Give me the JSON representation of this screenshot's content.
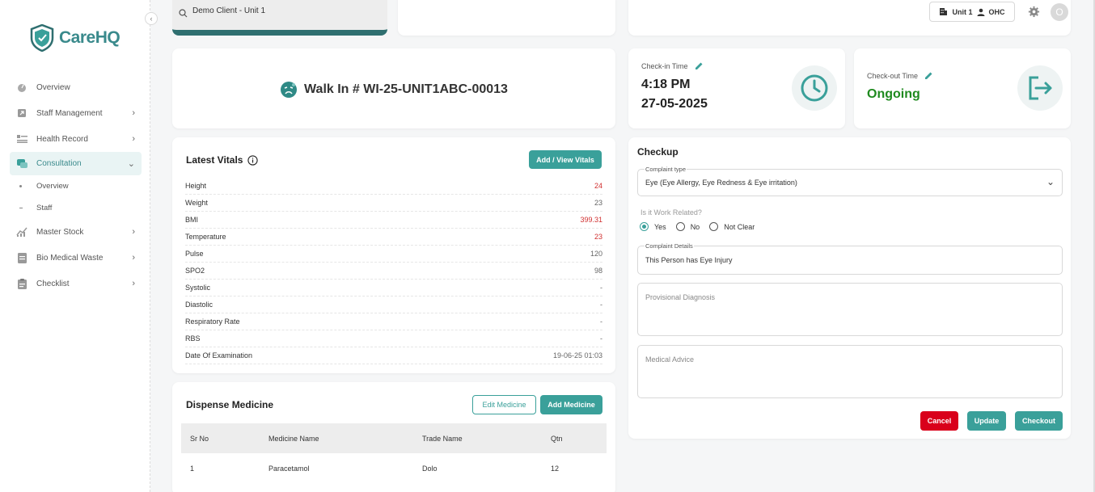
{
  "brand": {
    "name": "CareHQ"
  },
  "sidebar": {
    "items": [
      {
        "label": "Overview",
        "icon": "gauge-icon"
      },
      {
        "label": "Staff Management",
        "icon": "arrow-box-icon"
      },
      {
        "label": "Health Record",
        "icon": "list-icon"
      },
      {
        "label": "Consultation",
        "icon": "chat-icon"
      },
      {
        "label": "Master Stock",
        "icon": "chart-icon"
      },
      {
        "label": "Bio Medical Waste",
        "icon": "document-icon"
      },
      {
        "label": "Checklist",
        "icon": "clipboard-icon"
      }
    ],
    "sub_items": [
      "Overview",
      "Staff"
    ]
  },
  "search": {
    "value": "Demo Client - Unit 1"
  },
  "topbar": {
    "unit": "Unit 1",
    "role": "OHC",
    "avatar_initial": "O"
  },
  "walkin": {
    "title": "Walk In # WI-25-UNIT1ABC-00013"
  },
  "checkin": {
    "label": "Check-in Time",
    "time": "4:18 PM",
    "date": "27-05-2025"
  },
  "checkout": {
    "label": "Check-out Time",
    "status": "Ongoing",
    "status_color": "#1f8a1f"
  },
  "vitals": {
    "title": "Latest Vitals",
    "button": "Add / View Vitals",
    "rows": [
      {
        "label": "Height",
        "value": "24"
      },
      {
        "label": "Weight",
        "value": "23"
      },
      {
        "label": "BMI",
        "value": "399.31"
      },
      {
        "label": "Temperature",
        "value": "23"
      },
      {
        "label": "Pulse",
        "value": "120"
      },
      {
        "label": "SPO2",
        "value": "98"
      },
      {
        "label": "Systolic",
        "value": "-"
      },
      {
        "label": "Diastolic",
        "value": "-"
      },
      {
        "label": "Respiratory Rate",
        "value": "-"
      },
      {
        "label": "RBS",
        "value": "-"
      },
      {
        "label": "Date Of Examination",
        "value": "19-06-25 01:03"
      }
    ]
  },
  "medicine": {
    "title": "Dispense Medicine",
    "edit_button": "Edit Medicine",
    "add_button": "Add Medicine",
    "columns": [
      "Sr No",
      "Medicine Name",
      "Trade Name",
      "Qtn"
    ],
    "rows": [
      {
        "sr": "1",
        "name": "Paracetamol",
        "trade": "Dolo",
        "qty": "12"
      }
    ]
  },
  "checkup": {
    "title": "Checkup",
    "complaint_type_label": "Complaint type",
    "complaint_type_value": "Eye (Eye Allergy, Eye Redness & Eye irritation)",
    "work_related_question": "Is it Work Related?",
    "radio_options": [
      "Yes",
      "No",
      "Not Clear"
    ],
    "radio_selected": "Yes",
    "complaint_details_label": "Complaint Details",
    "complaint_details_value": "This Person has Eye Injury",
    "diagnosis_placeholder": "Provisional Diagnosis",
    "advice_placeholder": "Medical Advice",
    "cancel_button": "Cancel",
    "update_button": "Update",
    "checkout_button": "Checkout"
  },
  "colors": {
    "accent": "#3aa09a",
    "brand": "#3a8a8c",
    "danger": "#d9001b",
    "vital_alert": "#d03030"
  }
}
